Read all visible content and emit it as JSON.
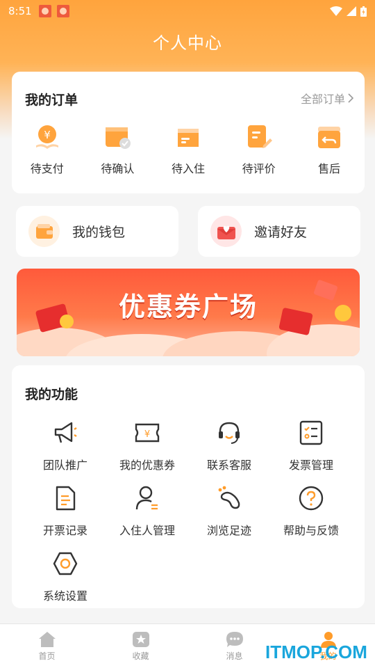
{
  "status_bar": {
    "time": "8:51"
  },
  "header": {
    "title": "个人中心"
  },
  "orders": {
    "title": "我的订单",
    "all_label": "全部订单",
    "items": [
      {
        "label": "待支付",
        "icon": "yuan-coin-hand-icon"
      },
      {
        "label": "待确认",
        "icon": "wallet-check-icon"
      },
      {
        "label": "待入住",
        "icon": "room-card-icon"
      },
      {
        "label": "待评价",
        "icon": "note-pencil-icon"
      },
      {
        "label": "售后",
        "icon": "return-box-icon"
      }
    ]
  },
  "quick_actions": {
    "wallet": {
      "label": "我的钱包",
      "icon": "wallet-icon"
    },
    "invite": {
      "label": "邀请好友",
      "icon": "heart-envelope-icon"
    }
  },
  "banner": {
    "title": "优惠券广场"
  },
  "functions": {
    "title": "我的功能",
    "items": [
      {
        "label": "团队推广",
        "icon": "megaphone-icon"
      },
      {
        "label": "我的优惠券",
        "icon": "coupon-icon"
      },
      {
        "label": "联系客服",
        "icon": "headset-icon"
      },
      {
        "label": "发票管理",
        "icon": "invoice-checklist-icon"
      },
      {
        "label": "开票记录",
        "icon": "document-icon"
      },
      {
        "label": "入住人管理",
        "icon": "person-manage-icon"
      },
      {
        "label": "浏览足迹",
        "icon": "footprint-icon"
      },
      {
        "label": "帮助与反馈",
        "icon": "help-circle-icon"
      },
      {
        "label": "系统设置",
        "icon": "settings-hexagon-icon"
      }
    ]
  },
  "tabbar": {
    "items": [
      {
        "label": "首页",
        "icon": "home-icon"
      },
      {
        "label": "收藏",
        "icon": "favorite-icon"
      },
      {
        "label": "消息",
        "icon": "message-icon"
      },
      {
        "label": "我的",
        "icon": "profile-icon"
      }
    ],
    "active_index": 3
  },
  "watermark": "ITMOP.COM",
  "colors": {
    "accent": "#ff9c2a",
    "banner": "#ff5a3b",
    "watermark": "#1aa6dc"
  }
}
